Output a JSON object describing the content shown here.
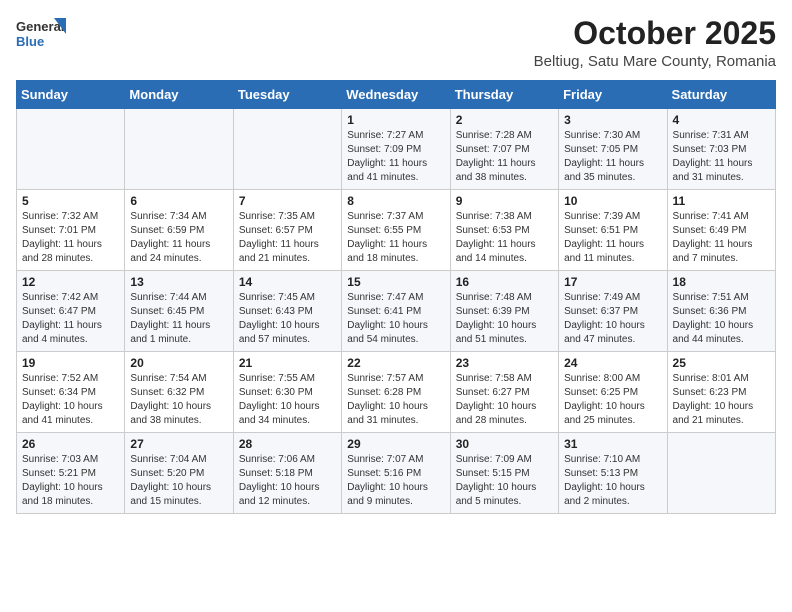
{
  "header": {
    "logo_general": "General",
    "logo_blue": "Blue",
    "month_title": "October 2025",
    "subtitle": "Beltiug, Satu Mare County, Romania"
  },
  "weekdays": [
    "Sunday",
    "Monday",
    "Tuesday",
    "Wednesday",
    "Thursday",
    "Friday",
    "Saturday"
  ],
  "weeks": [
    [
      {
        "day": "",
        "text": ""
      },
      {
        "day": "",
        "text": ""
      },
      {
        "day": "",
        "text": ""
      },
      {
        "day": "1",
        "text": "Sunrise: 7:27 AM\nSunset: 7:09 PM\nDaylight: 11 hours\nand 41 minutes."
      },
      {
        "day": "2",
        "text": "Sunrise: 7:28 AM\nSunset: 7:07 PM\nDaylight: 11 hours\nand 38 minutes."
      },
      {
        "day": "3",
        "text": "Sunrise: 7:30 AM\nSunset: 7:05 PM\nDaylight: 11 hours\nand 35 minutes."
      },
      {
        "day": "4",
        "text": "Sunrise: 7:31 AM\nSunset: 7:03 PM\nDaylight: 11 hours\nand 31 minutes."
      }
    ],
    [
      {
        "day": "5",
        "text": "Sunrise: 7:32 AM\nSunset: 7:01 PM\nDaylight: 11 hours\nand 28 minutes."
      },
      {
        "day": "6",
        "text": "Sunrise: 7:34 AM\nSunset: 6:59 PM\nDaylight: 11 hours\nand 24 minutes."
      },
      {
        "day": "7",
        "text": "Sunrise: 7:35 AM\nSunset: 6:57 PM\nDaylight: 11 hours\nand 21 minutes."
      },
      {
        "day": "8",
        "text": "Sunrise: 7:37 AM\nSunset: 6:55 PM\nDaylight: 11 hours\nand 18 minutes."
      },
      {
        "day": "9",
        "text": "Sunrise: 7:38 AM\nSunset: 6:53 PM\nDaylight: 11 hours\nand 14 minutes."
      },
      {
        "day": "10",
        "text": "Sunrise: 7:39 AM\nSunset: 6:51 PM\nDaylight: 11 hours\nand 11 minutes."
      },
      {
        "day": "11",
        "text": "Sunrise: 7:41 AM\nSunset: 6:49 PM\nDaylight: 11 hours\nand 7 minutes."
      }
    ],
    [
      {
        "day": "12",
        "text": "Sunrise: 7:42 AM\nSunset: 6:47 PM\nDaylight: 11 hours\nand 4 minutes."
      },
      {
        "day": "13",
        "text": "Sunrise: 7:44 AM\nSunset: 6:45 PM\nDaylight: 11 hours\nand 1 minute."
      },
      {
        "day": "14",
        "text": "Sunrise: 7:45 AM\nSunset: 6:43 PM\nDaylight: 10 hours\nand 57 minutes."
      },
      {
        "day": "15",
        "text": "Sunrise: 7:47 AM\nSunset: 6:41 PM\nDaylight: 10 hours\nand 54 minutes."
      },
      {
        "day": "16",
        "text": "Sunrise: 7:48 AM\nSunset: 6:39 PM\nDaylight: 10 hours\nand 51 minutes."
      },
      {
        "day": "17",
        "text": "Sunrise: 7:49 AM\nSunset: 6:37 PM\nDaylight: 10 hours\nand 47 minutes."
      },
      {
        "day": "18",
        "text": "Sunrise: 7:51 AM\nSunset: 6:36 PM\nDaylight: 10 hours\nand 44 minutes."
      }
    ],
    [
      {
        "day": "19",
        "text": "Sunrise: 7:52 AM\nSunset: 6:34 PM\nDaylight: 10 hours\nand 41 minutes."
      },
      {
        "day": "20",
        "text": "Sunrise: 7:54 AM\nSunset: 6:32 PM\nDaylight: 10 hours\nand 38 minutes."
      },
      {
        "day": "21",
        "text": "Sunrise: 7:55 AM\nSunset: 6:30 PM\nDaylight: 10 hours\nand 34 minutes."
      },
      {
        "day": "22",
        "text": "Sunrise: 7:57 AM\nSunset: 6:28 PM\nDaylight: 10 hours\nand 31 minutes."
      },
      {
        "day": "23",
        "text": "Sunrise: 7:58 AM\nSunset: 6:27 PM\nDaylight: 10 hours\nand 28 minutes."
      },
      {
        "day": "24",
        "text": "Sunrise: 8:00 AM\nSunset: 6:25 PM\nDaylight: 10 hours\nand 25 minutes."
      },
      {
        "day": "25",
        "text": "Sunrise: 8:01 AM\nSunset: 6:23 PM\nDaylight: 10 hours\nand 21 minutes."
      }
    ],
    [
      {
        "day": "26",
        "text": "Sunrise: 7:03 AM\nSunset: 5:21 PM\nDaylight: 10 hours\nand 18 minutes."
      },
      {
        "day": "27",
        "text": "Sunrise: 7:04 AM\nSunset: 5:20 PM\nDaylight: 10 hours\nand 15 minutes."
      },
      {
        "day": "28",
        "text": "Sunrise: 7:06 AM\nSunset: 5:18 PM\nDaylight: 10 hours\nand 12 minutes."
      },
      {
        "day": "29",
        "text": "Sunrise: 7:07 AM\nSunset: 5:16 PM\nDaylight: 10 hours\nand 9 minutes."
      },
      {
        "day": "30",
        "text": "Sunrise: 7:09 AM\nSunset: 5:15 PM\nDaylight: 10 hours\nand 5 minutes."
      },
      {
        "day": "31",
        "text": "Sunrise: 7:10 AM\nSunset: 5:13 PM\nDaylight: 10 hours\nand 2 minutes."
      },
      {
        "day": "",
        "text": ""
      }
    ]
  ]
}
